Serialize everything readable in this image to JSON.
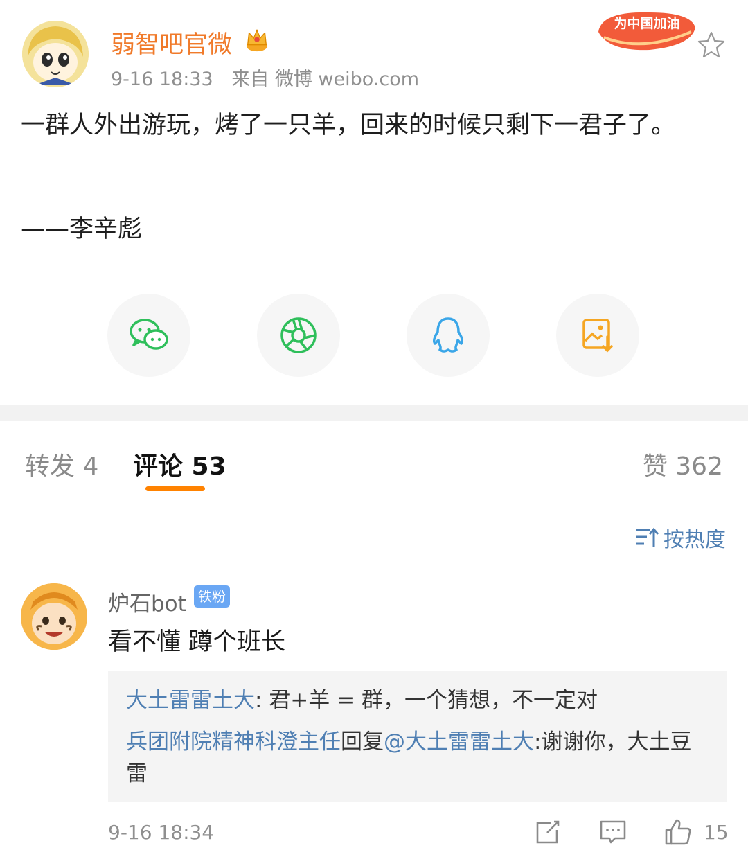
{
  "post": {
    "author_name": "弱智吧官微",
    "time": "9-16 18:33",
    "source": "来自 微博 weibo.com",
    "badge_text": "为中国加油",
    "body": "一群人外出游玩，烤了一只羊，回来的时候只剩下一君子了。",
    "signature": "——李辛彪"
  },
  "share_icons": [
    "wechat-icon",
    "moments-icon",
    "qq-icon",
    "save-image-icon"
  ],
  "tabs": {
    "repost": "转发 4",
    "comments": "评论 53",
    "likes": "赞 362"
  },
  "sort_label": "按热度",
  "comment": {
    "user": "炉石bot",
    "badge": "铁粉",
    "text": "看不懂 蹲个班长",
    "time": "9-16 18:34",
    "like_count": "15",
    "replies": [
      {
        "user": "大土雷雷土大",
        "sep": ": ",
        "text": "君+羊 = 群，一个猜想，不一定对"
      },
      {
        "user": "兵团附院精神科澄主任",
        "mid": "回复",
        "mention": "@大土雷雷土大",
        "text": ":谢谢你，大土豆雷"
      }
    ]
  },
  "colors": {
    "brand_orange": "#ff8200",
    "author_name": "#f07a2a",
    "link_blue": "#4f7fb3",
    "fan_badge": "#6aa7f4"
  }
}
